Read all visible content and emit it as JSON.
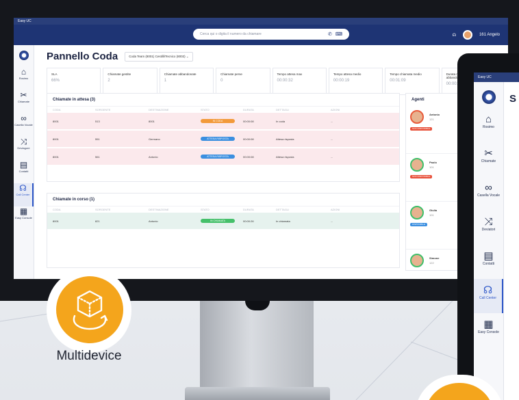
{
  "colors": {
    "brand": "#1e3474",
    "accent": "#f4a51c",
    "active": "#2c56c8"
  },
  "desktop": {
    "app_title": "Easy UC",
    "search_placeholder": "Cerca qui o digita il numero da chiamare",
    "user_name": "161 Angelo",
    "sidebar": [
      {
        "icon": "house-icon",
        "label": "Rosimo"
      },
      {
        "icon": "scissors-icon",
        "label": "Chiamate"
      },
      {
        "icon": "voicemail-icon",
        "label": "Casella Vocale"
      },
      {
        "icon": "shuffle-icon",
        "label": "Deviagure"
      },
      {
        "icon": "contacts-icon",
        "label": "Contatti"
      },
      {
        "icon": "headset-icon",
        "label": "Call Center"
      },
      {
        "icon": "grid-icon",
        "label": "Easy Console"
      }
    ],
    "page_title": "Pannello Coda",
    "queue_selector": "Coda Team (8001) Cestilli/Tecnico (8002)",
    "kpis": [
      {
        "label": "SLA",
        "value": "66%"
      },
      {
        "label": "Chiamate gestite",
        "value": "2"
      },
      {
        "label": "Chiamate abbandonate",
        "value": "1"
      },
      {
        "label": "Chiamate perse",
        "value": "0"
      },
      {
        "label": "Tempo attesa max",
        "value": "00:00:32"
      },
      {
        "label": "Tempo attesa medio",
        "value": "00:00:19"
      },
      {
        "label": "Tempo chiamata medio",
        "value": "00:01:09"
      },
      {
        "label": "Durata media chiamate abbandonate",
        "value": "00:00:03"
      }
    ],
    "waiting": {
      "title": "Chiamate in attesa (3)",
      "columns": [
        "CODA",
        "SORGENTE",
        "DESTINAZIONE",
        "STATO",
        "DURATA",
        "DETTAGLI",
        "AZIONI"
      ],
      "rows": [
        {
          "coda": "8001",
          "sorgente": "513",
          "destinazione": "8001",
          "stato": "IN CODA",
          "color": "#f29a3a",
          "durata": "00:00:08",
          "dettagli": "In coda",
          "azioni": "..."
        },
        {
          "coda": "8001",
          "sorgente": "551",
          "destinazione": "Germano",
          "stato": "ATTESA RISPOSTA",
          "color": "#3b8fe0",
          "durata": "00:00:08",
          "dettagli": "Attesa risposta",
          "azioni": "..."
        },
        {
          "coda": "8001",
          "sorgente": "561",
          "destinazione": "Antonio",
          "stato": "ATTESA RISPOSTA",
          "color": "#3b8fe0",
          "durata": "00:00:08",
          "dettagli": "Attesa risposta",
          "azioni": "..."
        }
      ]
    },
    "in_progress": {
      "title": "Chiamate in corso (1)",
      "columns": [
        "CODA",
        "SORGENTE",
        "DESTINAZIONE",
        "STATO",
        "DURATA",
        "DETTAGLI",
        "AZIONI"
      ],
      "rows": [
        {
          "coda": "8001",
          "sorgente": "821",
          "destinazione": "Antonio",
          "stato": "IN CHIAMATA",
          "color": "#45c06a",
          "durata": "00:00:26",
          "dettagli": "In chiamata",
          "azioni": "..."
        }
      ]
    },
    "agents": {
      "title": "Agenti",
      "list": [
        {
          "name": "Antonio",
          "ext": "121",
          "status": "NON DISPONIBILE",
          "status_color": "#e8503a",
          "ring": "#e85a3a"
        },
        {
          "name": "Paolo",
          "ext": "101",
          "status": "NON DISPONIBILE",
          "status_color": "#e8503a",
          "ring": "#3fbf6a"
        },
        {
          "name": "Giulia",
          "ext": "101",
          "status": "DISPONIBILE",
          "status_color": "#3b8fe0",
          "ring": "#3fbf6a"
        },
        {
          "name": "Simone",
          "ext": "122",
          "status": "",
          "status_color": "#3fbf6a",
          "ring": "#3fbf6a"
        }
      ]
    }
  },
  "tablet": {
    "app_title": "Easy UC",
    "heading_initial": "S",
    "sidebar": [
      {
        "icon": "house-icon",
        "label": "Rosimo"
      },
      {
        "icon": "scissors-icon",
        "label": "Chiamate"
      },
      {
        "icon": "voicemail-icon",
        "label": "Casella Vocale"
      },
      {
        "icon": "shuffle-icon",
        "label": "Deviatori"
      },
      {
        "icon": "contacts-icon",
        "label": "Contatti"
      },
      {
        "icon": "headset-icon",
        "label": "Call Center"
      },
      {
        "icon": "grid-icon",
        "label": "Easy Console"
      }
    ]
  },
  "feature_label": "Multidevice"
}
